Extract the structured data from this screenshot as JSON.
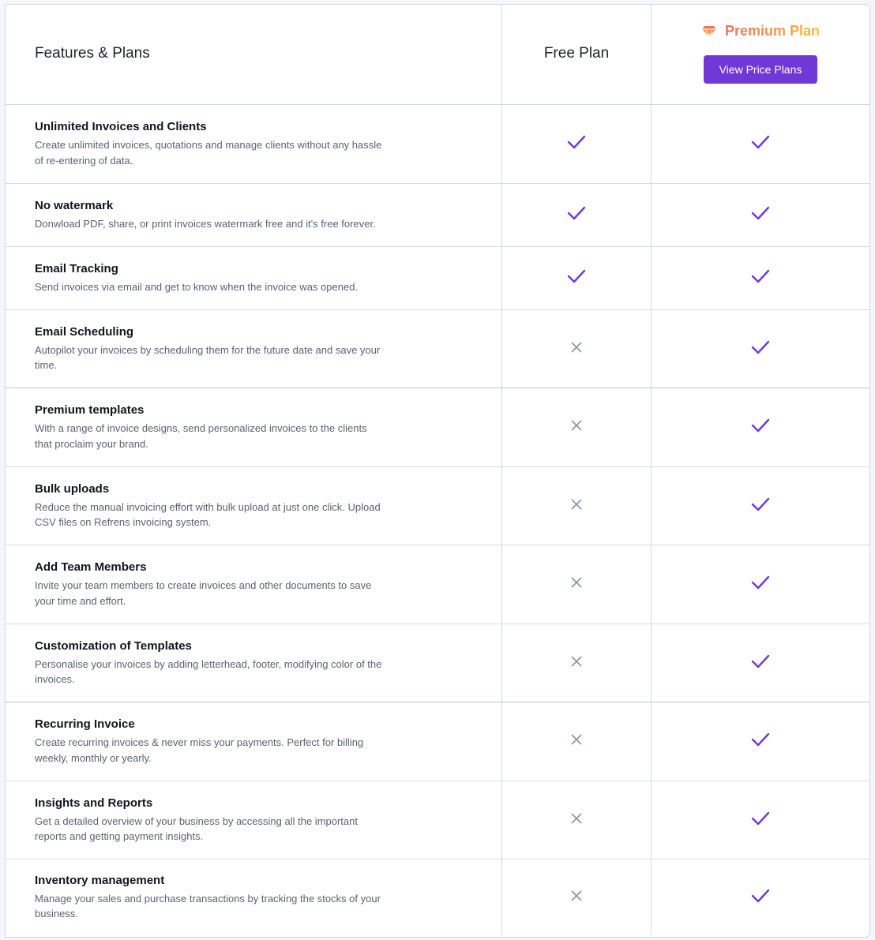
{
  "header": {
    "features_label": "Features & Plans",
    "free_label": "Free Plan",
    "premium_label": "Premium Plan",
    "premium_icon": "diamond-icon",
    "view_button_label": "View Price Plans"
  },
  "colors": {
    "accent": "#7138d8",
    "check": "#7138d8",
    "cross": "#8a93a6",
    "premium_gradient_start": "#f0715f",
    "premium_gradient_end": "#f9bd3a"
  },
  "features": [
    {
      "title": "Unlimited Invoices and Clients",
      "description": "Create unlimited invoices, quotations and manage clients without any hassle of re-entering of data.",
      "free": true,
      "premium": true
    },
    {
      "title": "No watermark",
      "description": "Donwload PDF, share, or print invoices watermark free and it's free forever.",
      "free": true,
      "premium": true
    },
    {
      "title": "Email Tracking",
      "description": "Send invoices via email and get to know when the invoice was opened.",
      "free": true,
      "premium": true
    },
    {
      "title": "Email Scheduling",
      "description": "Autopilot your invoices by scheduling them for the future date and save your time.",
      "free": false,
      "premium": true
    },
    {
      "title": "Premium templates",
      "description": "With a range of invoice designs, send personalized invoices to the clients that proclaim your brand.",
      "free": false,
      "premium": true
    },
    {
      "title": "Bulk uploads",
      "description": "Reduce the manual invoicing effort with bulk upload at just one click. Upload CSV files on Refrens invoicing system.",
      "free": false,
      "premium": true
    },
    {
      "title": "Add Team Members",
      "description": "Invite your team members to create invoices and other documents to save your time and effort.",
      "free": false,
      "premium": true
    },
    {
      "title": "Customization of Templates",
      "description": "Personalise your invoices by adding letterhead, footer, modifying color of the invoices.",
      "free": false,
      "premium": true
    },
    {
      "title": "Recurring Invoice",
      "description": "Create recurring invoices & never miss your payments. Perfect for billing weekly, monthly or yearly.",
      "free": false,
      "premium": true
    },
    {
      "title": "Insights and Reports",
      "description": "Get a detailed overview of your business by accessing all the important reports and getting payment insights.",
      "free": false,
      "premium": true
    },
    {
      "title": "Inventory management",
      "description": "Manage your sales and purchase transactions by tracking the stocks of your business.",
      "free": false,
      "premium": true
    }
  ]
}
